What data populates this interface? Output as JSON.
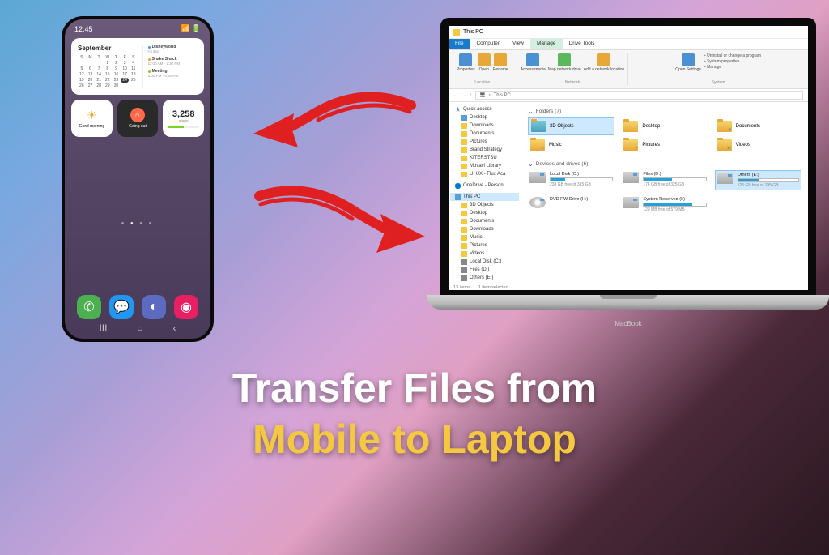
{
  "headline": {
    "line1": "Transfer Files from",
    "line2": "Mobile to Laptop"
  },
  "laptop": {
    "brand": "MacBook"
  },
  "phone": {
    "status_time": "12:45",
    "calendar": {
      "month": "September",
      "day_headers": [
        "S",
        "M",
        "T",
        "W",
        "T",
        "F",
        "S"
      ],
      "days": [
        "",
        "",
        "",
        "1",
        "2",
        "3",
        "4",
        "5",
        "6",
        "7",
        "8",
        "9",
        "10",
        "11",
        "12",
        "13",
        "14",
        "15",
        "16",
        "17",
        "18",
        "19",
        "20",
        "21",
        "22",
        "23",
        "24",
        "25",
        "26",
        "27",
        "28",
        "29",
        "30",
        ""
      ],
      "today": "24",
      "events": [
        {
          "title": "Disneyworld",
          "sub": "All day"
        },
        {
          "title": "Shake Shack",
          "sub": "11:00 AM - 2:30 PM"
        },
        {
          "title": "Meeting",
          "sub": "3:00 PM - 4:30 PM"
        }
      ]
    },
    "morning": "Good morning",
    "going_out": "Going out",
    "steps_value": "3,258",
    "steps_label": "steps"
  },
  "explorer": {
    "window_title": "This PC",
    "tabs": {
      "file": "File",
      "computer": "Computer",
      "view": "View",
      "manage": "Manage",
      "drive_tools": "Drive Tools"
    },
    "ribbon": {
      "properties": "Properties",
      "open": "Open",
      "rename": "Rename",
      "access_media": "Access media",
      "map_drive": "Map network drive",
      "add_network": "Add a network location",
      "open_settings": "Open Settings",
      "uninstall": "Uninstall or change a program",
      "system_props": "System properties",
      "manage": "Manage",
      "grp_location": "Location",
      "grp_network": "Network",
      "grp_system": "System"
    },
    "breadcrumb": "This PC",
    "sidebar": {
      "quick_access": "Quick access",
      "desktop": "Desktop",
      "downloads": "Downloads",
      "documents": "Documents",
      "pictures": "Pictures",
      "brand": "Brand Strategy",
      "kiterstsu": "KITERSTSU",
      "movavi": "Movavi Library",
      "uiux": "UI UX - Flux Aca",
      "onedrive": "OneDrive - Person",
      "this_pc": "This PC",
      "objects3d": "3D Objects",
      "music": "Music",
      "videos": "Videos",
      "local_c": "Local Disk (C:)",
      "files_d": "Files (D:)",
      "others_e": "Others (E:)"
    },
    "sections": {
      "folders": "Folders (7)",
      "devices": "Devices and drives (6)"
    },
    "folders": {
      "objects3d": "3D Objects",
      "desktop": "Desktop",
      "documents": "Documents",
      "music": "Music",
      "pictures": "Pictures",
      "videos": "Videos"
    },
    "drives": {
      "c": {
        "name": "Local Disk (C:)",
        "free": "238 GB free of 315 GB",
        "pct": 24
      },
      "d": {
        "name": "Files (D:)",
        "free": "174 GB free of 325 GB",
        "pct": 46
      },
      "e": {
        "name": "Others (E:)",
        "free": "125 GB free of 195 GB",
        "pct": 36
      },
      "dvd": {
        "name": "DVD RW Drive (H:)"
      },
      "i": {
        "name": "System Reserved (I:)",
        "free": "129 MB free of 579 MB",
        "pct": 78
      }
    },
    "status": {
      "items": "13 items",
      "selected": "1 item selected"
    }
  }
}
